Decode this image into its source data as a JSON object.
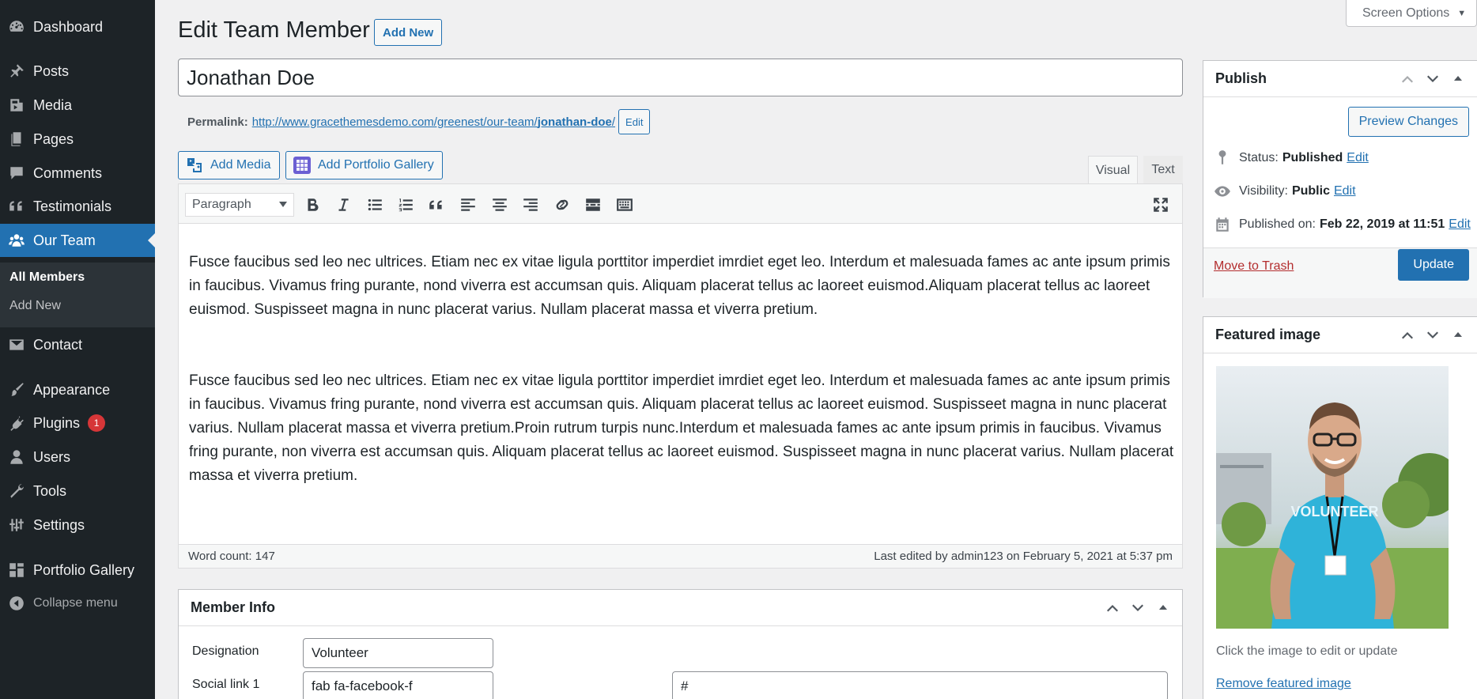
{
  "sidebar": {
    "items": [
      {
        "label": "Dashboard",
        "icon": "dashboard-icon"
      },
      {
        "label": "Posts",
        "icon": "pin-icon"
      },
      {
        "label": "Media",
        "icon": "media-icon"
      },
      {
        "label": "Pages",
        "icon": "pages-icon"
      },
      {
        "label": "Comments",
        "icon": "comments-icon"
      },
      {
        "label": "Testimonials",
        "icon": "quote-icon"
      },
      {
        "label": "Our Team",
        "icon": "groups-icon"
      },
      {
        "label": "Contact",
        "icon": "email-icon"
      },
      {
        "label": "Appearance",
        "icon": "paintbrush-icon"
      },
      {
        "label": "Plugins",
        "icon": "plugins-icon",
        "badge": "1"
      },
      {
        "label": "Users",
        "icon": "users-icon"
      },
      {
        "label": "Tools",
        "icon": "tools-icon"
      },
      {
        "label": "Settings",
        "icon": "settings-icon"
      },
      {
        "label": "Portfolio Gallery",
        "icon": "grid-icon"
      }
    ],
    "submenu": [
      "All Members",
      "Add New"
    ],
    "collapse_label": "Collapse menu"
  },
  "screen_options": "Screen Options",
  "page": {
    "title": "Edit Team Member",
    "add_new": "Add New",
    "post_title": "Jonathan Doe",
    "permalink_label": "Permalink:",
    "permalink_base": "http://www.gracethemesdemo.com/greenest/our-team/",
    "permalink_slug": "jonathan-doe",
    "permalink_end": "/",
    "permalink_edit": "Edit"
  },
  "editor": {
    "add_media": "Add Media",
    "add_portfolio": "Add Portfolio Gallery",
    "tab_visual": "Visual",
    "tab_text": "Text",
    "format": "Paragraph",
    "paragraphs": [
      "Fusce faucibus sed leo nec ultrices. Etiam nec ex vitae ligula porttitor imperdiet imrdiet eget leo. Interdum et malesuada fames ac ante ipsum primis in faucibus. Vivamus fring purante, nond viverra est accumsan quis. Aliquam placerat tellus ac laoreet euismod.Aliquam placerat tellus ac laoreet euismod. Suspisseet magna in nunc placerat varius. Nullam placerat massa et viverra pretium.",
      "Fusce faucibus sed leo nec ultrices. Etiam nec ex vitae ligula porttitor imperdiet imrdiet eget leo. Interdum et malesuada fames ac ante ipsum primis in faucibus. Vivamus fring purante, nond viverra est accumsan quis. Aliquam placerat tellus ac laoreet euismod. Suspisseet magna in nunc placerat varius. Nullam placerat massa et viverra pretium.Proin rutrum turpis nunc.Interdum et malesuada fames ac ante ipsum primis in faucibus. Vivamus fring purante, non viverra est accumsan quis. Aliquam placerat tellus ac laoreet euismod. Suspisseet magna in nunc placerat varius. Nullam placerat massa et viverra pretium."
    ],
    "word_count": "Word count: 147",
    "last_edited": "Last edited by admin123 on February 5, 2021 at 5:37 pm"
  },
  "member_info": {
    "title": "Member Info",
    "designation_label": "Designation",
    "designation_value": "Volunteer",
    "social1_label": "Social link 1",
    "social1_icon": "fab fa-facebook-f",
    "social1_url": "#"
  },
  "publish": {
    "title": "Publish",
    "preview": "Preview Changes",
    "status_label": "Status:",
    "status_value": "Published",
    "visibility_label": "Visibility:",
    "visibility_value": "Public",
    "published_label": "Published on:",
    "published_value": "Feb 22, 2019 at 11:51",
    "edit": "Edit",
    "trash": "Move to Trash",
    "update": "Update"
  },
  "featured": {
    "title": "Featured image",
    "hint": "Click the image to edit or update",
    "remove": "Remove featured image",
    "shirt_text": "VOLUNTEER"
  },
  "colors": {
    "sidebar_bg": "#1d2327",
    "accent": "#2271b1",
    "shirt": "#2fb3d9"
  }
}
